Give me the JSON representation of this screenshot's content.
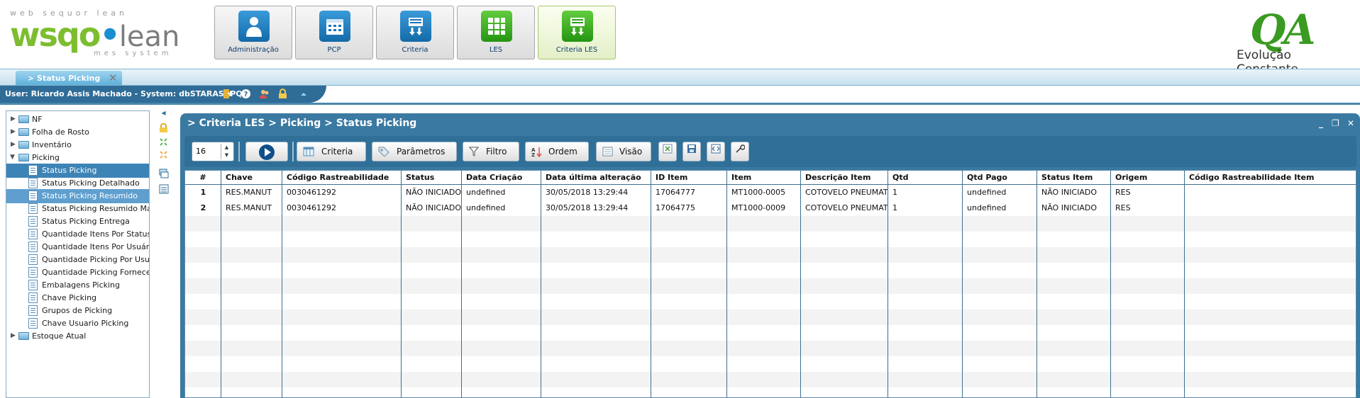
{
  "brand": {
    "tagline": "web sequor lean",
    "logo_wsq": "wsqo",
    "logo_dot": "•",
    "logo_lean": "lean",
    "subtitle": "mes system",
    "qa_logo": "QA",
    "qa_slogan": "Evolução Constante"
  },
  "modules": [
    {
      "label": "Administração",
      "icon": "user-icon",
      "color": "#1b74b7"
    },
    {
      "label": "PCP",
      "icon": "calendar-icon",
      "color": "#1b74b7"
    },
    {
      "label": "Criteria",
      "icon": "criteria-icon",
      "color": "#1b74b7"
    },
    {
      "label": "LES",
      "icon": "grid-icon",
      "color": "#2c9e1a"
    },
    {
      "label": "Criteria LES",
      "icon": "criteria-icon",
      "color": "#2c9e1a"
    }
  ],
  "tab": {
    "label": "> Status Picking",
    "close": "✕"
  },
  "userbar": {
    "text": "User: Ricardo Assis Machado - System: dbSTARASAPQA"
  },
  "tree": {
    "items": [
      {
        "label": "NF",
        "type": "folder",
        "state": "collapsed"
      },
      {
        "label": "Folha de Rosto",
        "type": "folder",
        "state": "collapsed"
      },
      {
        "label": "Inventário",
        "type": "folder",
        "state": "collapsed"
      },
      {
        "label": "Picking",
        "type": "folder",
        "state": "expanded"
      },
      {
        "label": "Status Picking",
        "type": "page",
        "state": "selected"
      },
      {
        "label": "Status Picking Detalhado",
        "type": "page"
      },
      {
        "label": "Status Picking Resumido",
        "type": "page",
        "state": "highlighted"
      },
      {
        "label": "Status Picking Resumido Mar",
        "type": "page"
      },
      {
        "label": "Status Picking Entrega",
        "type": "page"
      },
      {
        "label": "Quantidade Itens Por Status",
        "type": "page"
      },
      {
        "label": "Quantidade Itens Por Usuáric",
        "type": "page"
      },
      {
        "label": "Quantidade Picking Por Usuá",
        "type": "page"
      },
      {
        "label": "Quantidade Picking Forneced",
        "type": "page"
      },
      {
        "label": "Embalagens Picking",
        "type": "page"
      },
      {
        "label": "Chave Picking",
        "type": "page"
      },
      {
        "label": "Grupos de Picking",
        "type": "page"
      },
      {
        "label": "Chave Usuario Picking",
        "type": "page"
      },
      {
        "label": "Estoque Atual",
        "type": "folder",
        "state": "collapsed"
      }
    ]
  },
  "panel": {
    "title": "> Criteria LES > Picking > Status Picking",
    "minimize": "_",
    "restore": "❐",
    "close": "✕"
  },
  "toolbar": {
    "page_size": "16",
    "criteria_label": "Criteria",
    "parametros_label": "Parâmetros",
    "filtro_label": "Filtro",
    "ordem_label": "Ordem",
    "visao_label": "Visão"
  },
  "grid": {
    "columns": [
      "#",
      "Chave",
      "Código Rastreabilidade",
      "Status",
      "Data Criação",
      "Data última alteração",
      "ID Item",
      "Item",
      "Descrição Item",
      "Qtd",
      "Qtd Pago",
      "Status Item",
      "Origem",
      "Código Rastreabilidade Item"
    ],
    "rows": [
      [
        "1",
        "RES.MANUT",
        "0030461292",
        "NÃO INICIADO",
        "undefined",
        "30/05/2018 13:29:44",
        "17064777",
        "MT1000-0005",
        "COTOVELO PNEUMATIC",
        "1",
        "undefined",
        "NÃO INICIADO",
        "RES",
        ""
      ],
      [
        "2",
        "RES.MANUT",
        "0030461292",
        "NÃO INICIADO",
        "undefined",
        "30/05/2018 13:29:44",
        "17064775",
        "MT1000-0009",
        "COTOVELO PNEUMATIC",
        "1",
        "undefined",
        "NÃO INICIADO",
        "RES",
        ""
      ]
    ]
  }
}
